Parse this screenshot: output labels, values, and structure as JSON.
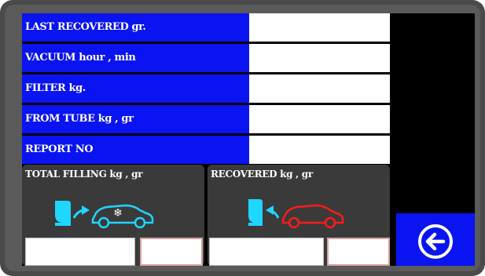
{
  "fields": [
    {
      "label": "LAST RECOVERED gr.",
      "value": ""
    },
    {
      "label": "VACUUM hour , min",
      "value": ""
    },
    {
      "label": "FILTER kg.",
      "value": ""
    },
    {
      "label": "FROM TUBE kg , gr",
      "value": ""
    },
    {
      "label": "REPORT NO",
      "value": ""
    }
  ],
  "total_filling": {
    "title": "TOTAL FILLING kg , gr",
    "kg": "",
    "gr": "",
    "icon": "machine-to-car-snowflake"
  },
  "recovered": {
    "title": "RECOVERED kg , gr",
    "kg": "",
    "gr": "",
    "icon": "car-to-machine"
  },
  "back_button": {
    "icon": "back-arrow-icon"
  },
  "colors": {
    "label_bg": "#0a14f0",
    "screen_bg": "#000000",
    "panel_bg": "#3a3a3a",
    "accent_cyan": "#1fd6ff",
    "accent_red": "#ff1a1a"
  }
}
